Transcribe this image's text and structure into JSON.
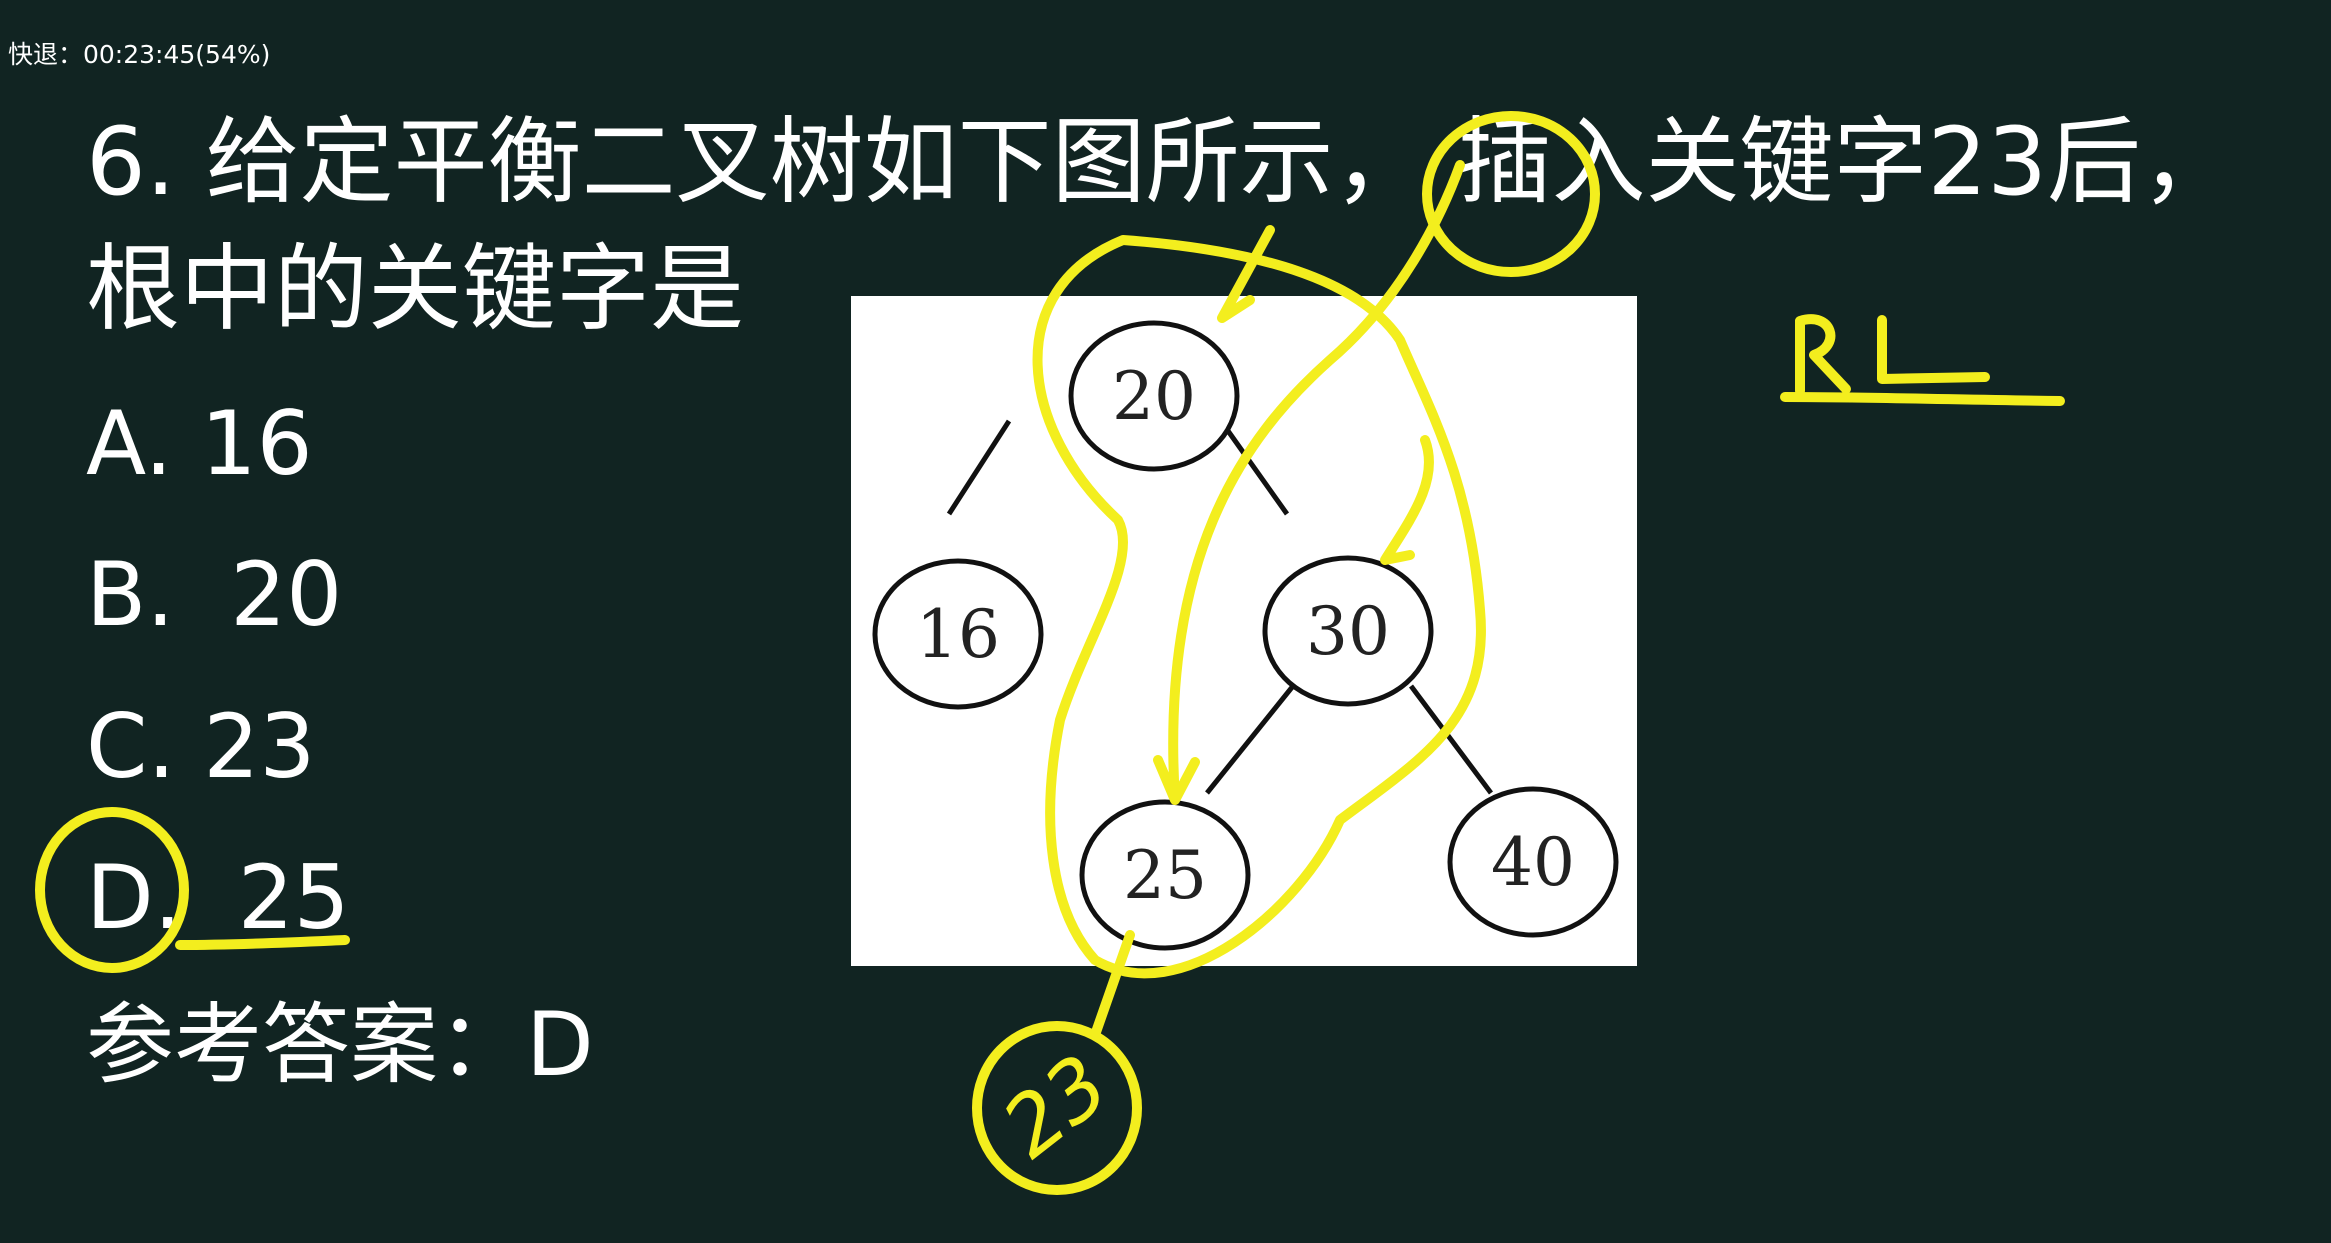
{
  "player": {
    "seek_status": "快退：00:23:45(54%)"
  },
  "question": {
    "line1": "6. 给定平衡二叉树如下图所示， 插入关键字23后，",
    "line2": "根中的关键字是"
  },
  "options": [
    {
      "label": "A.",
      "spacing": " ",
      "value": "16"
    },
    {
      "label": "B.",
      "spacing": "  ",
      "value": "20"
    },
    {
      "label": "C.",
      "spacing": " ",
      "value": "23"
    },
    {
      "label": "D.",
      "spacing": "  ",
      "value": "25"
    }
  ],
  "answer": {
    "text": "参考答案：D"
  },
  "tree": {
    "nodes": [
      "20",
      "16",
      "30",
      "25",
      "40"
    ]
  },
  "annotations": {
    "rotation_type": "RL",
    "inserted_key": "23",
    "ink_color": "#f3ee1e"
  }
}
